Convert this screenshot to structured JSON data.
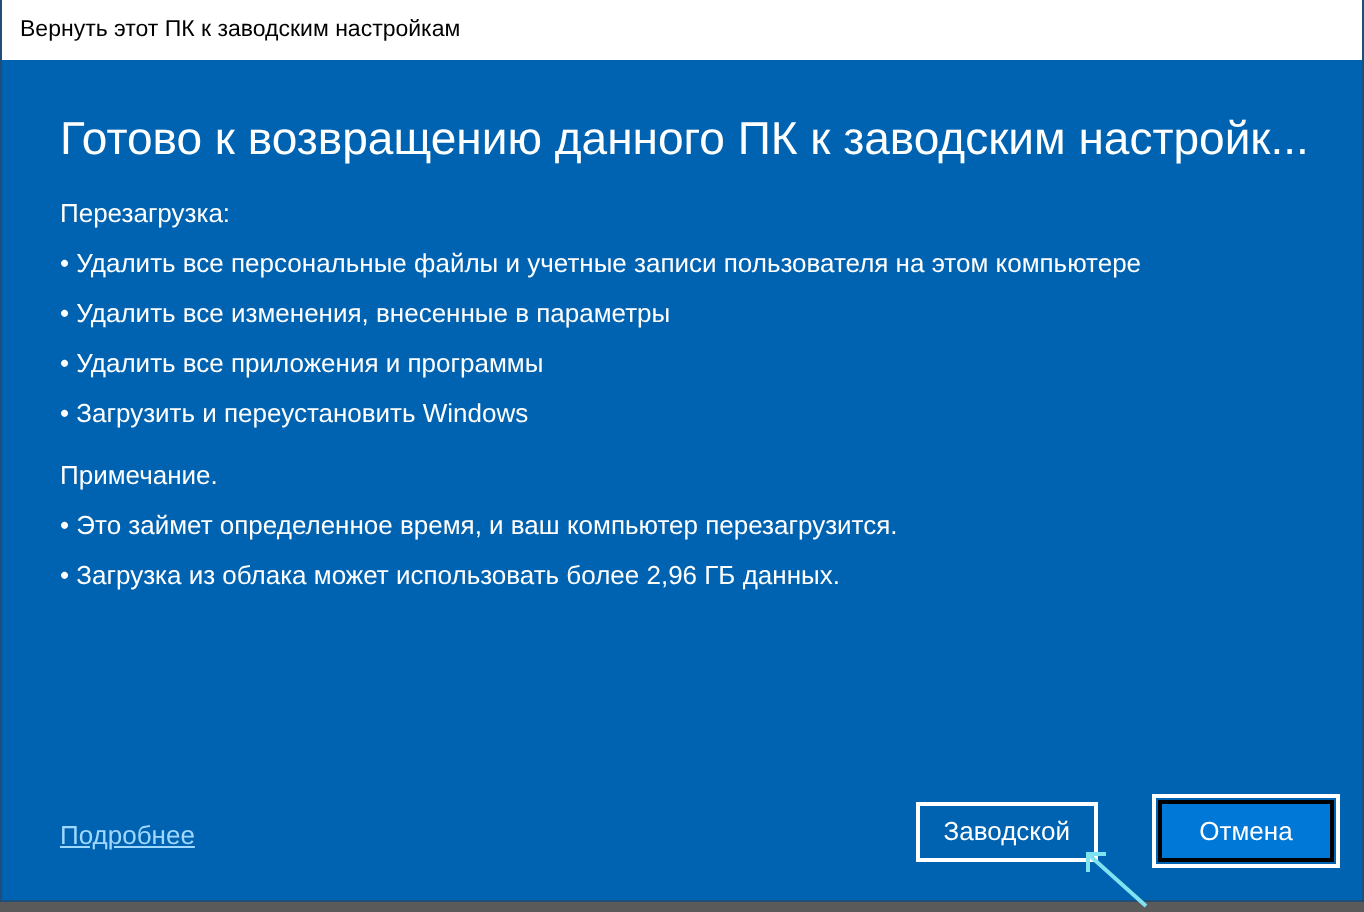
{
  "window": {
    "title": "Вернуть этот ПК к заводским настройкам"
  },
  "heading": "Готово к возвращению данного ПК к заводским настройк...",
  "sections": [
    {
      "title": "Перезагрузка:",
      "items": [
        "• Удалить все персональные файлы и учетные записи пользователя на этом компьютере",
        "• Удалить все изменения, внесенные в параметры",
        "• Удалить все приложения и программы",
        "•  Загрузить и переустановить Windows"
      ]
    },
    {
      "title": "Примечание.",
      "items": [
        "•  Это займет определенное время, и ваш компьютер перезагрузится.",
        "•  Загрузка из облака может использовать более 2,96 ГБ данных."
      ]
    }
  ],
  "link": "Подробнее",
  "buttons": [
    {
      "label": "Заводской",
      "focused": false
    },
    {
      "label": "Отмена",
      "focused": true
    }
  ]
}
